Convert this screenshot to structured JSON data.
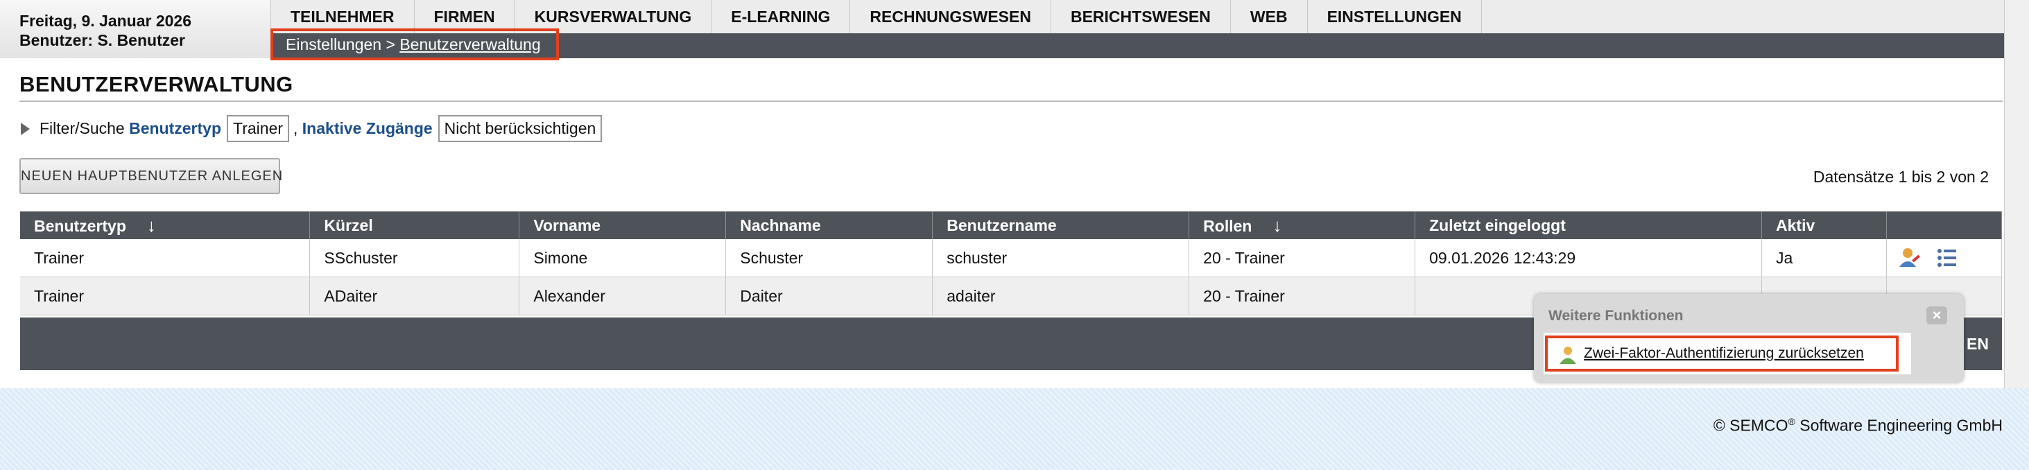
{
  "info": {
    "date": "Freitag, 9. Januar 2026",
    "user": "Benutzer: S. Benutzer"
  },
  "nav": {
    "tabs": [
      "TEILNEHMER",
      "FIRMEN",
      "KURSVERWALTUNG",
      "E-LEARNING",
      "RECHNUNGSWESEN",
      "BERICHTSWESEN",
      "WEB",
      "EINSTELLUNGEN"
    ]
  },
  "breadcrumb": {
    "parent": "Einstellungen",
    "separator": ">",
    "current": "Benutzerverwaltung"
  },
  "page": {
    "title": "BENUTZERVERWALTUNG"
  },
  "filter": {
    "label": "Filter/Suche",
    "field1_label": "Benutzertyp",
    "field1_value": "Trainer",
    "separator": ",",
    "field2_label": "Inaktive Zugänge",
    "field2_value": "Nicht berücksichtigen"
  },
  "toolbar": {
    "new_button": "NEUEN HAUPTBENUTZER ANLEGEN",
    "record_count": "Datensätze 1 bis 2 von 2"
  },
  "table": {
    "headers": [
      "Benutzertyp",
      "Kürzel",
      "Vorname",
      "Nachname",
      "Benutzername",
      "Rollen",
      "Zuletzt eingeloggt",
      "Aktiv",
      ""
    ],
    "sort_arrow": "↓",
    "rows": [
      [
        "Trainer",
        "SSchuster",
        "Simone",
        "Schuster",
        "schuster",
        "20 - Trainer",
        "09.01.2026 12:43:29",
        "Ja"
      ],
      [
        "Trainer",
        "ADaiter",
        "Alexander",
        "Daiter",
        "adaiter",
        "20 - Trainer",
        "",
        ""
      ]
    ]
  },
  "footer": {
    "partial_button_text": "EN",
    "copyright_company": "© SEMCO",
    "copyright_reg": "®",
    "copyright_rest": " Software Engineering GmbH"
  },
  "popup": {
    "title": "Weitere Funktionen",
    "close": "×",
    "link": "Zwei-Faktor-Authentifizierung zurücksetzen"
  },
  "colors": {
    "accent_highlight": "#e2401e",
    "dark_bar": "#4e5359",
    "link_blue": "#1d4f8a"
  }
}
